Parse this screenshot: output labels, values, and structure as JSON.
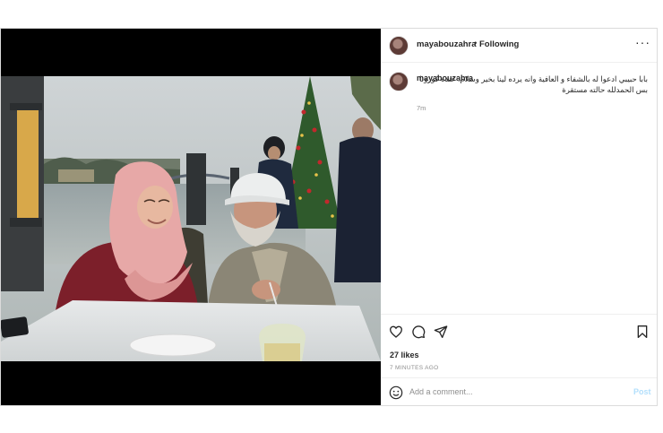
{
  "post": {
    "username": "mayabouzahra",
    "separator": "•",
    "follow_status": "Following",
    "more_icon": "more-horizontal-icon",
    "photo_description_icon": "photo-image"
  },
  "caption": {
    "username": "mayabouzahra",
    "text": "بابا حبيبي ادعوا له بالشفاء و العافية وانه يرده لينا بخير وسلام. عنده كورونا بس الحمدلله حالته مستقرة",
    "time": "7m"
  },
  "actions": {
    "icons": [
      "heart-icon",
      "comment-icon",
      "share-icon",
      "bookmark-icon"
    ],
    "likes": "27 likes",
    "time_ago": "7 MINUTES AGO"
  },
  "comment": {
    "placeholder": "Add a comment...",
    "post_label": "Post",
    "emoji_icon": "emoji-icon"
  },
  "colors": {
    "border": "#dbdbdb",
    "text": "#262626",
    "muted": "#8e8e8e",
    "post_disabled": "#b2dffc"
  }
}
